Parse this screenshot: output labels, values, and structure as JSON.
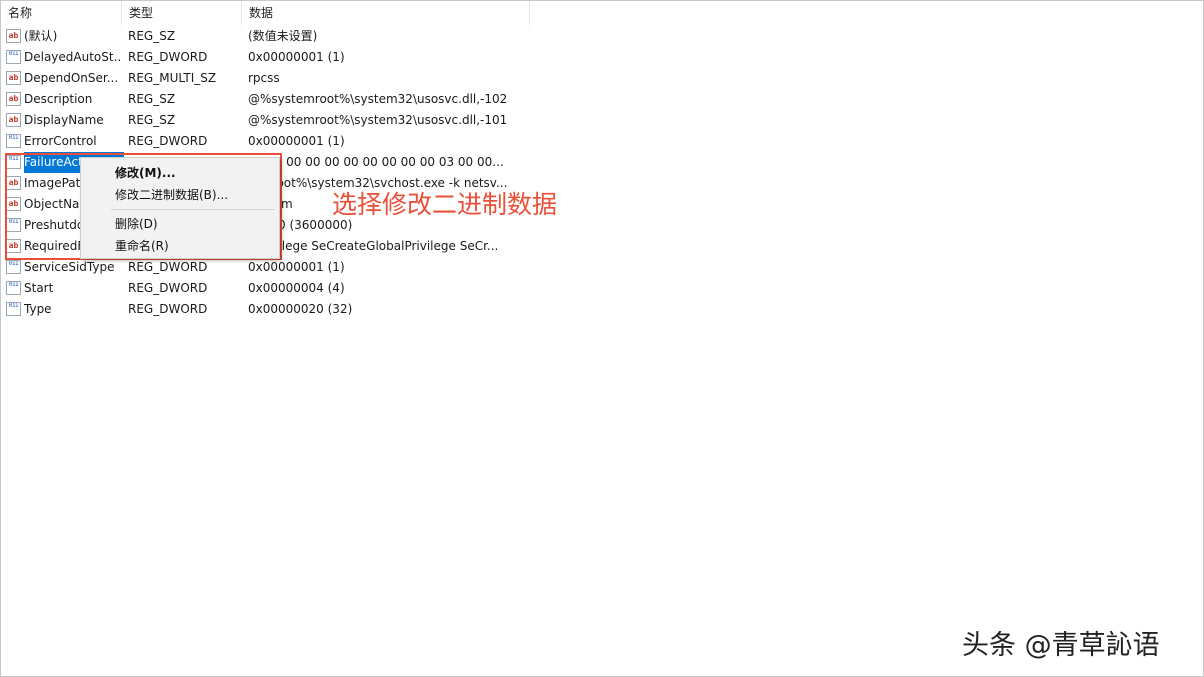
{
  "columns": {
    "name": "名称",
    "type": "类型",
    "data": "数据"
  },
  "rows": [
    {
      "icon": "string-value-icon",
      "icon_glyph": "ab",
      "name": "(默认)",
      "type": "REG_SZ",
      "data": "(数值未设置)"
    },
    {
      "icon": "binary-value-icon",
      "icon_glyph": "011",
      "name": "DelayedAutoSt...",
      "type": "REG_DWORD",
      "data": "0x00000001 (1)"
    },
    {
      "icon": "string-value-icon",
      "icon_glyph": "ab",
      "name": "DependOnSer...",
      "type": "REG_MULTI_SZ",
      "data": "rpcss"
    },
    {
      "icon": "string-value-icon",
      "icon_glyph": "ab",
      "name": "Description",
      "type": "REG_SZ",
      "data": "@%systemroot%\\system32\\usosvc.dll,-102"
    },
    {
      "icon": "string-value-icon",
      "icon_glyph": "ab",
      "name": "DisplayName",
      "type": "REG_SZ",
      "data": "@%systemroot%\\system32\\usosvc.dll,-101"
    },
    {
      "icon": "binary-value-icon",
      "icon_glyph": "011",
      "name": "ErrorControl",
      "type": "REG_DWORD",
      "data": "0x00000001 (1)"
    },
    {
      "icon": "binary-value-icon",
      "icon_glyph": "011",
      "name": "FailureAct",
      "type": "",
      "data": "01 00 00 00 00 00 00 00 00 00 03 00 00...",
      "selected": true
    },
    {
      "icon": "string-value-icon",
      "icon_glyph": "ab",
      "name": "ImagePat",
      "type": "",
      "data": "temroot%\\system32\\svchost.exe -k netsv..."
    },
    {
      "icon": "string-value-icon",
      "icon_glyph": "ab",
      "name": "ObjectNa",
      "type": "",
      "data": "System"
    },
    {
      "icon": "binary-value-icon",
      "icon_glyph": "011",
      "name": "Preshutdo",
      "type": "",
      "data": "6ee80 (3600000)"
    },
    {
      "icon": "string-value-icon",
      "icon_glyph": "ab",
      "name": "RequiredF",
      "type": "",
      "data": "itPrivilege SeCreateGlobalPrivilege SeCr..."
    },
    {
      "icon": "binary-value-icon",
      "icon_glyph": "011",
      "name": "ServiceSidType",
      "type": "REG_DWORD",
      "data": "0x00000001 (1)"
    },
    {
      "icon": "binary-value-icon",
      "icon_glyph": "011",
      "name": "Start",
      "type": "REG_DWORD",
      "data": "0x00000004 (4)"
    },
    {
      "icon": "binary-value-icon",
      "icon_glyph": "011",
      "name": "Type",
      "type": "REG_DWORD",
      "data": "0x00000020 (32)"
    }
  ],
  "context_menu": {
    "modify": "修改(M)...",
    "modify_binary": "修改二进制数据(B)...",
    "delete": "删除(D)",
    "rename": "重命名(R)"
  },
  "annotation": "选择修改二进制数据",
  "watermark": "头条 @青草訫语",
  "colors": {
    "annotation": "#e8503a",
    "selection": "#0078d7"
  }
}
